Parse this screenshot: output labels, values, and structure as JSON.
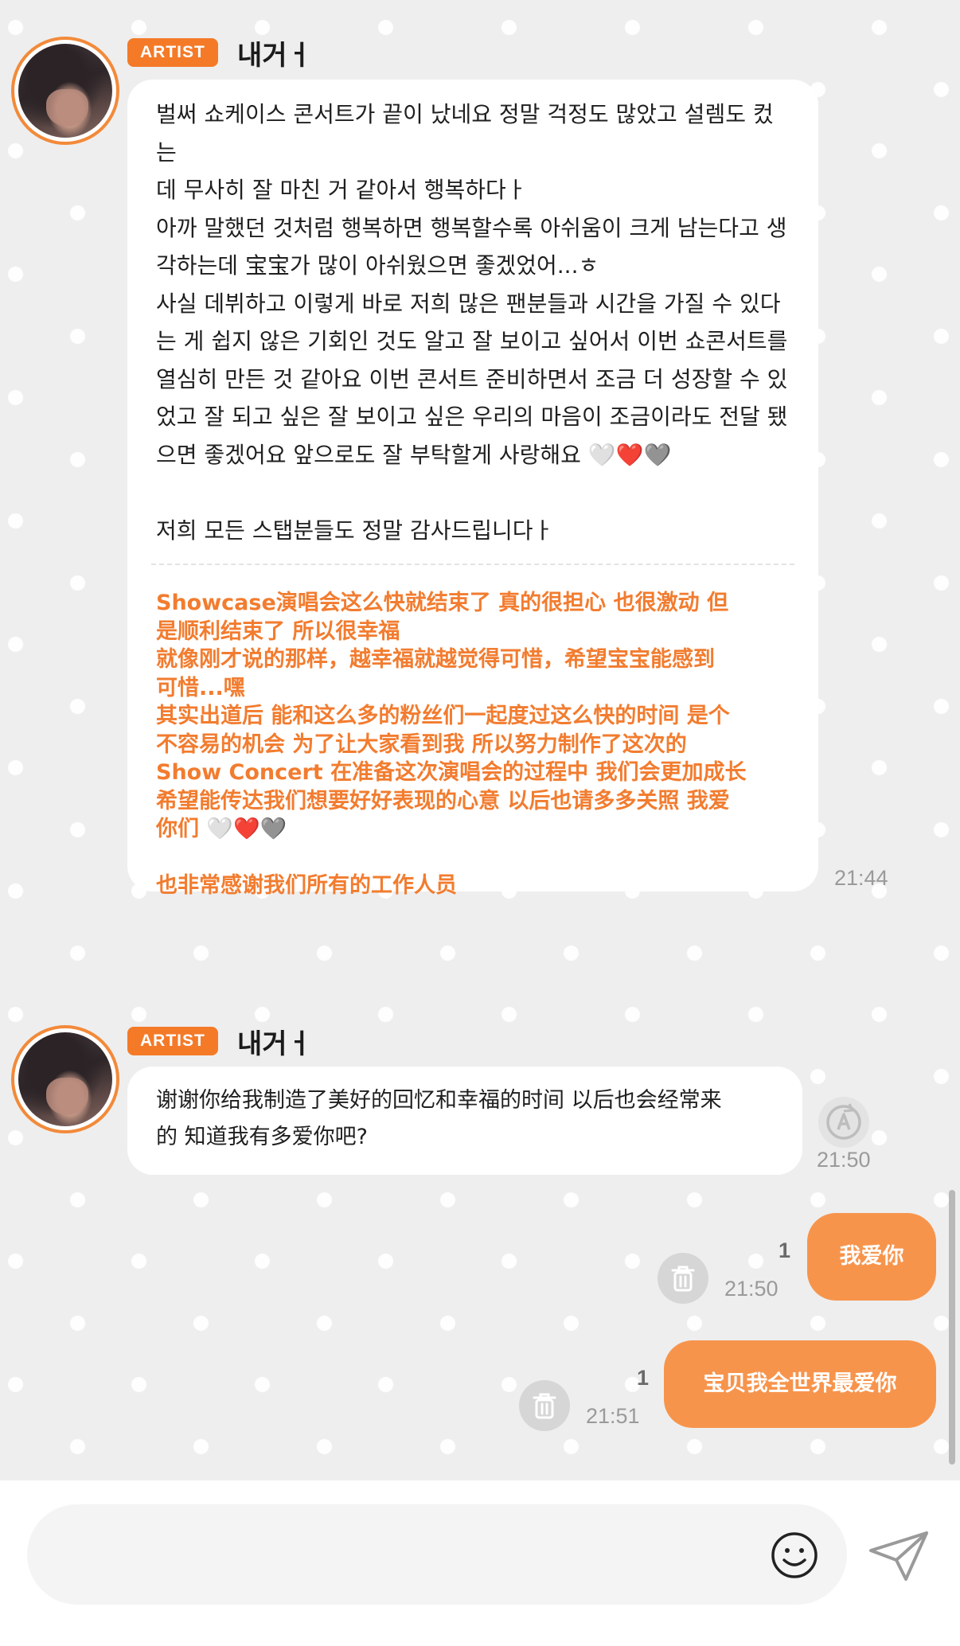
{
  "colors": {
    "accent": "#f47a28",
    "bubble_out": "#f7944c",
    "translation_text": "#f27c2f",
    "background": "#eeeeee"
  },
  "messages": [
    {
      "badge": "ARTIST",
      "sender": "내거ㅓ",
      "korean_lines": [
        "벌써 쇼케이스 콘서트가 끝이 났네요 정말 걱정도 많았고 설렘도 컸는",
        "데 무사히 잘 마친 거 같아서 행복하다ㅏ",
        "아까 말했던 것처럼 행복하면 행복할수록 아쉬움이 크게 남는다고 생",
        "각하는데 宝宝가 많이 아쉬웠으면 좋겠었어...ㅎ",
        "사실 데뷔하고 이렇게 바로 저희 많은 팬분들과 시간을 가질 수 있다",
        "는 게 쉽지 않은 기회인 것도 알고 잘 보이고 싶어서 이번 쇼콘서트를",
        "열심히 만든 것 같아요 이번 콘서트 준비하면서 조금 더 성장할 수 있",
        "었고 잘 되고 싶은 잘 보이고 싶은 우리의 마음이 조금이라도 전달 됐",
        "으면 좋겠어요 앞으로도 잘 부탁할게 사랑해요 🤍❤️🩶",
        "",
        "저희 모든 스탭분들도 정말 감사드립니다ㅏ"
      ],
      "chinese_lines": [
        "Showcase演唱会这么快就结束了 真的很担心 也很激动 但",
        "是顺利结束了 所以很幸福",
        "就像刚才说的那样，越幸福就越觉得可惜，希望宝宝能感到",
        "可惜...嘿",
        "其实出道后 能和这么多的粉丝们一起度过这么快的时间 是个",
        "不容易的机会 为了让大家看到我 所以努力制作了这次的",
        "Show Concert 在准备这次演唱会的过程中 我们会更加成长",
        "希望能传达我们想要好好表现的心意 以后也请多多关照 我爱",
        "你们 🤍❤️🩶",
        "",
        "也非常感谢我们所有的工作人员"
      ],
      "time": "21:44"
    },
    {
      "badge": "ARTIST",
      "sender": "내거ㅓ",
      "lines": [
        "谢谢你给我制造了美好的回忆和幸福的时间 以后也会经常来",
        "的 知道我有多爱你吧?"
      ],
      "time": "21:50"
    },
    {
      "text": "我爱你",
      "read_count": "1",
      "time": "21:50"
    },
    {
      "text": "宝贝我全世界最爱你",
      "read_count": "1",
      "time": "21:51"
    }
  ],
  "input": {
    "placeholder": ""
  }
}
